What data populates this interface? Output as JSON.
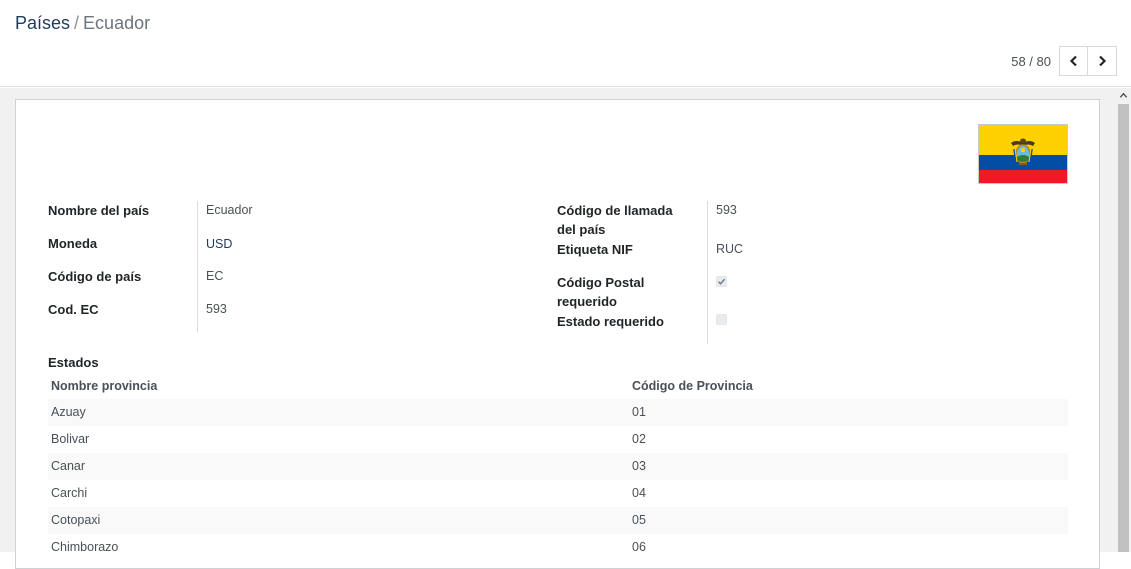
{
  "breadcrumb": {
    "parent": "Países",
    "separator": "/",
    "current": "Ecuador"
  },
  "pager": {
    "value": "58 / 80",
    "prev_icon": "chevron-left-icon",
    "next_icon": "chevron-right-icon"
  },
  "flag": {
    "country": "Ecuador",
    "colors": {
      "yellow": "#ffd100",
      "blue": "#034ea2",
      "red": "#ed1c24"
    }
  },
  "fields_left": {
    "country_name": {
      "label": "Nombre del país",
      "value": "Ecuador"
    },
    "currency": {
      "label": "Moneda",
      "value": "USD"
    },
    "country_code": {
      "label": "Código de país",
      "value": "EC"
    },
    "cod_ec": {
      "label": "Cod. EC",
      "value": "593"
    }
  },
  "fields_right": {
    "calling_code": {
      "label_line1": "Código de llamada",
      "label_line2": "del país",
      "value": "593"
    },
    "vat_label": {
      "label": "Etiqueta NIF",
      "value": "RUC"
    },
    "zip_required": {
      "label_line1": "Código Postal",
      "label_line2": "requerido",
      "checked": true
    },
    "state_required": {
      "label": "Estado requerido",
      "checked": false
    }
  },
  "states": {
    "title": "Estados",
    "columns": [
      "Nombre provincia",
      "Código de Provincia"
    ],
    "rows": [
      [
        "Azuay",
        "01"
      ],
      [
        "Bolivar",
        "02"
      ],
      [
        "Canar",
        "03"
      ],
      [
        "Carchi",
        "04"
      ],
      [
        "Cotopaxi",
        "05"
      ],
      [
        "Chimborazo",
        "06"
      ]
    ]
  },
  "colors": {
    "link": "#1f3a5a",
    "muted": "#6c757d",
    "background": "#f1f1f1",
    "border": "#dee2e6"
  }
}
